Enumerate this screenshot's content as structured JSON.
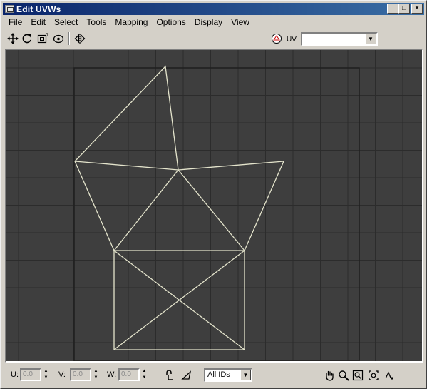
{
  "window": {
    "title": "Edit UVWs",
    "controls": {
      "minimize": "_",
      "maximize": "□",
      "close": "×"
    }
  },
  "menu": {
    "items": [
      "File",
      "Edit",
      "Select",
      "Tools",
      "Mapping",
      "Options",
      "Display",
      "View"
    ]
  },
  "toolbar": {
    "tools": [
      "move-icon",
      "rotate-icon",
      "scale-icon",
      "freeform-icon",
      "mirror-icon"
    ],
    "uv_label": "UV",
    "map_select_arrow": "▼"
  },
  "viewport": {
    "background": "#3e3e3e",
    "grid_color": "#2c2c2c",
    "mesh_color": "#e4e4cc"
  },
  "statusbar": {
    "u_label": "U:",
    "u_value": "0.0",
    "v_label": "V:",
    "v_value": "0.0",
    "w_label": "W:",
    "w_value": "0.0",
    "ids_value": "All IDs",
    "ids_arrow": "▼",
    "nav_tools": [
      "pan-icon",
      "zoom-icon",
      "zoom-region-icon",
      "zoom-extents-icon",
      "snap-icon"
    ]
  }
}
